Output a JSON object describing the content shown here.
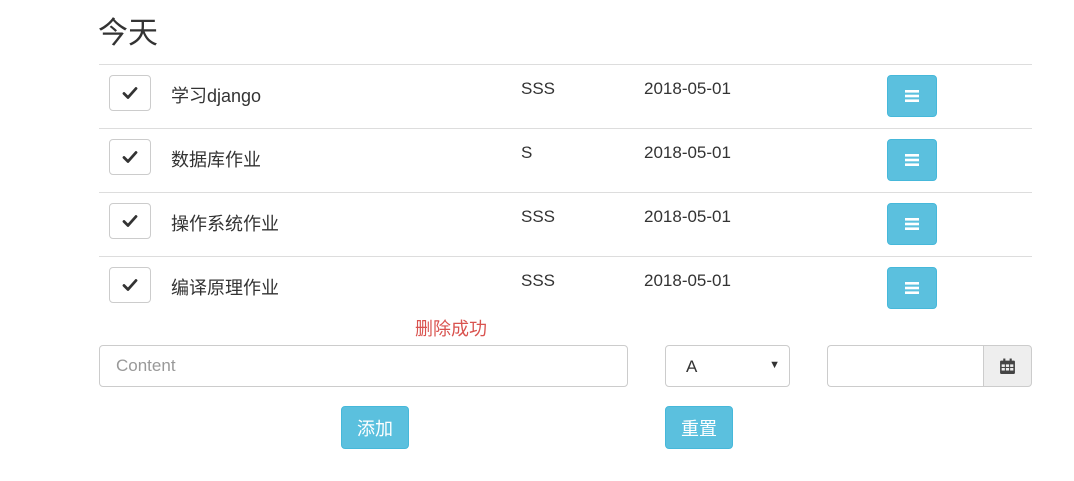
{
  "heading": "今天",
  "tasks": [
    {
      "title": "学习django",
      "tag": "SSS",
      "date": "2018-05-01"
    },
    {
      "title": "数据库作业",
      "tag": "S",
      "date": "2018-05-01"
    },
    {
      "title": "操作系统作业",
      "tag": "SSS",
      "date": "2018-05-01"
    },
    {
      "title": "编译原理作业",
      "tag": "SSS",
      "date": "2018-05-01"
    }
  ],
  "status_message": "删除成功",
  "form": {
    "content_placeholder": "Content",
    "content_value": "",
    "priority_selected": "A",
    "date_value": "",
    "add_label": "添加",
    "reset_label": "重置"
  },
  "colors": {
    "info": "#5bc0de",
    "danger": "#d9534f"
  },
  "icons": {
    "check": "check-icon",
    "menu": "menu-icon",
    "calendar": "calendar-icon"
  }
}
